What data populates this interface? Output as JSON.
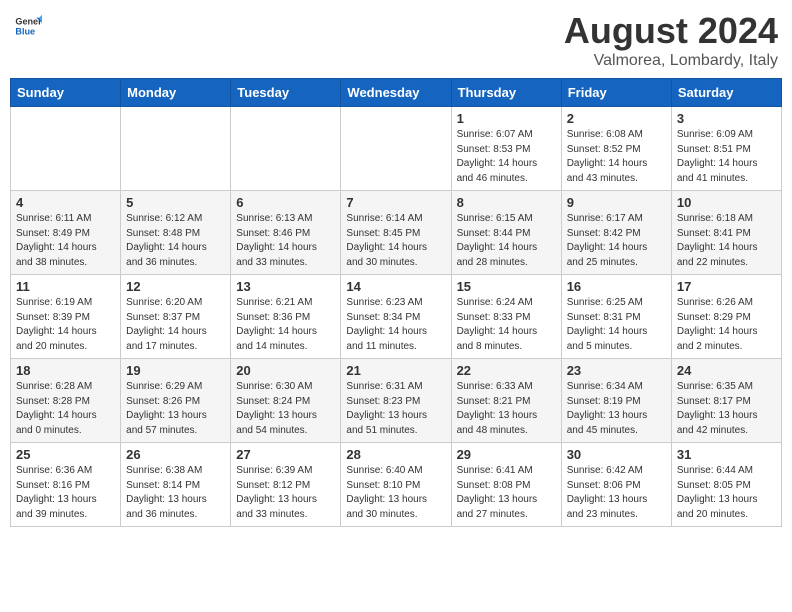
{
  "logo": {
    "general": "General",
    "blue": "Blue"
  },
  "title": "August 2024",
  "location": "Valmorea, Lombardy, Italy",
  "weekdays": [
    "Sunday",
    "Monday",
    "Tuesday",
    "Wednesday",
    "Thursday",
    "Friday",
    "Saturday"
  ],
  "weeks": [
    [
      {
        "day": "",
        "info": ""
      },
      {
        "day": "",
        "info": ""
      },
      {
        "day": "",
        "info": ""
      },
      {
        "day": "",
        "info": ""
      },
      {
        "day": "1",
        "info": "Sunrise: 6:07 AM\nSunset: 8:53 PM\nDaylight: 14 hours\nand 46 minutes."
      },
      {
        "day": "2",
        "info": "Sunrise: 6:08 AM\nSunset: 8:52 PM\nDaylight: 14 hours\nand 43 minutes."
      },
      {
        "day": "3",
        "info": "Sunrise: 6:09 AM\nSunset: 8:51 PM\nDaylight: 14 hours\nand 41 minutes."
      }
    ],
    [
      {
        "day": "4",
        "info": "Sunrise: 6:11 AM\nSunset: 8:49 PM\nDaylight: 14 hours\nand 38 minutes."
      },
      {
        "day": "5",
        "info": "Sunrise: 6:12 AM\nSunset: 8:48 PM\nDaylight: 14 hours\nand 36 minutes."
      },
      {
        "day": "6",
        "info": "Sunrise: 6:13 AM\nSunset: 8:46 PM\nDaylight: 14 hours\nand 33 minutes."
      },
      {
        "day": "7",
        "info": "Sunrise: 6:14 AM\nSunset: 8:45 PM\nDaylight: 14 hours\nand 30 minutes."
      },
      {
        "day": "8",
        "info": "Sunrise: 6:15 AM\nSunset: 8:44 PM\nDaylight: 14 hours\nand 28 minutes."
      },
      {
        "day": "9",
        "info": "Sunrise: 6:17 AM\nSunset: 8:42 PM\nDaylight: 14 hours\nand 25 minutes."
      },
      {
        "day": "10",
        "info": "Sunrise: 6:18 AM\nSunset: 8:41 PM\nDaylight: 14 hours\nand 22 minutes."
      }
    ],
    [
      {
        "day": "11",
        "info": "Sunrise: 6:19 AM\nSunset: 8:39 PM\nDaylight: 14 hours\nand 20 minutes."
      },
      {
        "day": "12",
        "info": "Sunrise: 6:20 AM\nSunset: 8:37 PM\nDaylight: 14 hours\nand 17 minutes."
      },
      {
        "day": "13",
        "info": "Sunrise: 6:21 AM\nSunset: 8:36 PM\nDaylight: 14 hours\nand 14 minutes."
      },
      {
        "day": "14",
        "info": "Sunrise: 6:23 AM\nSunset: 8:34 PM\nDaylight: 14 hours\nand 11 minutes."
      },
      {
        "day": "15",
        "info": "Sunrise: 6:24 AM\nSunset: 8:33 PM\nDaylight: 14 hours\nand 8 minutes."
      },
      {
        "day": "16",
        "info": "Sunrise: 6:25 AM\nSunset: 8:31 PM\nDaylight: 14 hours\nand 5 minutes."
      },
      {
        "day": "17",
        "info": "Sunrise: 6:26 AM\nSunset: 8:29 PM\nDaylight: 14 hours\nand 2 minutes."
      }
    ],
    [
      {
        "day": "18",
        "info": "Sunrise: 6:28 AM\nSunset: 8:28 PM\nDaylight: 14 hours\nand 0 minutes."
      },
      {
        "day": "19",
        "info": "Sunrise: 6:29 AM\nSunset: 8:26 PM\nDaylight: 13 hours\nand 57 minutes."
      },
      {
        "day": "20",
        "info": "Sunrise: 6:30 AM\nSunset: 8:24 PM\nDaylight: 13 hours\nand 54 minutes."
      },
      {
        "day": "21",
        "info": "Sunrise: 6:31 AM\nSunset: 8:23 PM\nDaylight: 13 hours\nand 51 minutes."
      },
      {
        "day": "22",
        "info": "Sunrise: 6:33 AM\nSunset: 8:21 PM\nDaylight: 13 hours\nand 48 minutes."
      },
      {
        "day": "23",
        "info": "Sunrise: 6:34 AM\nSunset: 8:19 PM\nDaylight: 13 hours\nand 45 minutes."
      },
      {
        "day": "24",
        "info": "Sunrise: 6:35 AM\nSunset: 8:17 PM\nDaylight: 13 hours\nand 42 minutes."
      }
    ],
    [
      {
        "day": "25",
        "info": "Sunrise: 6:36 AM\nSunset: 8:16 PM\nDaylight: 13 hours\nand 39 minutes."
      },
      {
        "day": "26",
        "info": "Sunrise: 6:38 AM\nSunset: 8:14 PM\nDaylight: 13 hours\nand 36 minutes."
      },
      {
        "day": "27",
        "info": "Sunrise: 6:39 AM\nSunset: 8:12 PM\nDaylight: 13 hours\nand 33 minutes."
      },
      {
        "day": "28",
        "info": "Sunrise: 6:40 AM\nSunset: 8:10 PM\nDaylight: 13 hours\nand 30 minutes."
      },
      {
        "day": "29",
        "info": "Sunrise: 6:41 AM\nSunset: 8:08 PM\nDaylight: 13 hours\nand 27 minutes."
      },
      {
        "day": "30",
        "info": "Sunrise: 6:42 AM\nSunset: 8:06 PM\nDaylight: 13 hours\nand 23 minutes."
      },
      {
        "day": "31",
        "info": "Sunrise: 6:44 AM\nSunset: 8:05 PM\nDaylight: 13 hours\nand 20 minutes."
      }
    ]
  ]
}
